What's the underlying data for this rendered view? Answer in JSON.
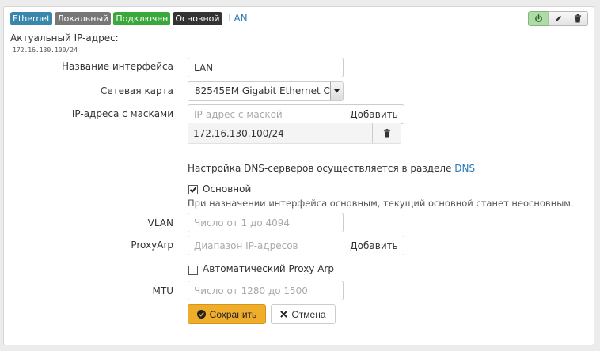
{
  "header": {
    "badges": [
      "Ethernet",
      "Локальный",
      "Подключен",
      "Основной"
    ],
    "title": "LAN",
    "tools": [
      "power-icon",
      "pencil-icon",
      "trash-icon"
    ]
  },
  "current_ip": {
    "label": "Актуальный IP-адрес:",
    "value": "172.16.130.100/24"
  },
  "form": {
    "name_label": "Название интерфейса",
    "name_value": "LAN",
    "nic_label": "Сетевая карта",
    "nic_value": "82545EM Gigabit Ethernet Co",
    "ip_label": "IP-адреса с масками",
    "ip_placeholder": "IP-адрес с маской",
    "add_label": "Добавить",
    "ip_list": [
      "172.16.130.100/24"
    ],
    "dns_text": "Настройка DNS-серверов осуществляется в разделе ",
    "dns_link": "DNS",
    "main_label": "Основной",
    "main_checked": true,
    "main_hint": "При назначении интерфейса основным, текущий основной станет неосновным.",
    "vlan_label": "VLAN",
    "vlan_placeholder": "Число от 1 до 4094",
    "proxyarp_label": "ProxyArp",
    "proxyarp_placeholder": "Диапазон IP-адресов",
    "proxyarp_add": "Добавить",
    "auto_proxy_label": "Автоматический Proxy Arp",
    "auto_proxy_checked": false,
    "mtu_label": "MTU",
    "mtu_placeholder": "Число от 1280 до 1500",
    "save_label": "Сохранить",
    "cancel_label": "Отмена"
  },
  "colors": {
    "badge_ethernet": "#3a87ad",
    "badge_local": "#777777",
    "badge_connected": "#3aa83a",
    "badge_main": "#333333",
    "link": "#2a7ab8",
    "save_button": "#f0ad2c"
  }
}
